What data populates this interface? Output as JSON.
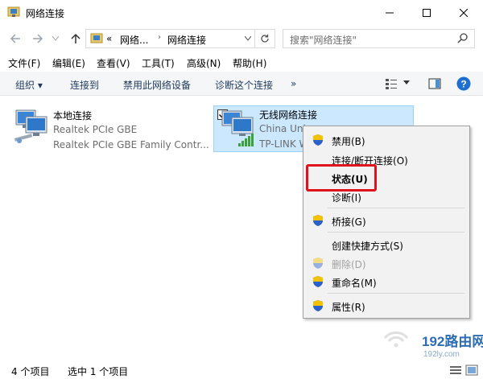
{
  "window": {
    "title": "网络连接",
    "controls": {
      "minimize": "—",
      "maximize": "☐",
      "close": "✕"
    }
  },
  "address": {
    "overflow": "«",
    "crumbs": [
      "网络...",
      "网络连接"
    ],
    "search_placeholder": "搜索\"网络连接\""
  },
  "menubar": [
    "文件(F)",
    "编辑(E)",
    "查看(V)",
    "工具(T)",
    "高级(N)",
    "帮助(H)"
  ],
  "commandbar": {
    "organize": "组织 ▾",
    "connect_to": "连接到",
    "disable": "禁用此网络设备",
    "diagnose": "诊断这个连接",
    "more": "»"
  },
  "connections": [
    {
      "name": "本地连接",
      "line2": "Realtek PCIe GBE",
      "line3": "Realtek PCIe GBE Family Contr..."
    },
    {
      "name": "无线网络连接",
      "line2": "China Uni",
      "line3": "TP-LINK W",
      "selected": true
    }
  ],
  "context_menu": {
    "items": [
      {
        "label": "禁用(B)",
        "shield": true
      },
      {
        "label": "连接/断开连接(O)"
      },
      {
        "label": "状态(U)",
        "bold": true,
        "highlighted": true
      },
      {
        "label": "诊断(I)"
      },
      {
        "label": "桥接(G)",
        "shield": true
      },
      {
        "label": "创建快捷方式(S)"
      },
      {
        "label": "删除(D)",
        "shield": true,
        "disabled": true
      },
      {
        "label": "重命名(M)",
        "shield": true
      },
      {
        "label": "属性(R)",
        "shield": true
      }
    ]
  },
  "statusbar": {
    "count": "4 个项目",
    "selected": "选中 1 个项目"
  },
  "watermark": {
    "brand": "192路由网",
    "url": "192ly.com"
  },
  "colors": {
    "accent": "#0078d7",
    "selection": "#cce8ff",
    "highlight_border": "#e0121b"
  }
}
